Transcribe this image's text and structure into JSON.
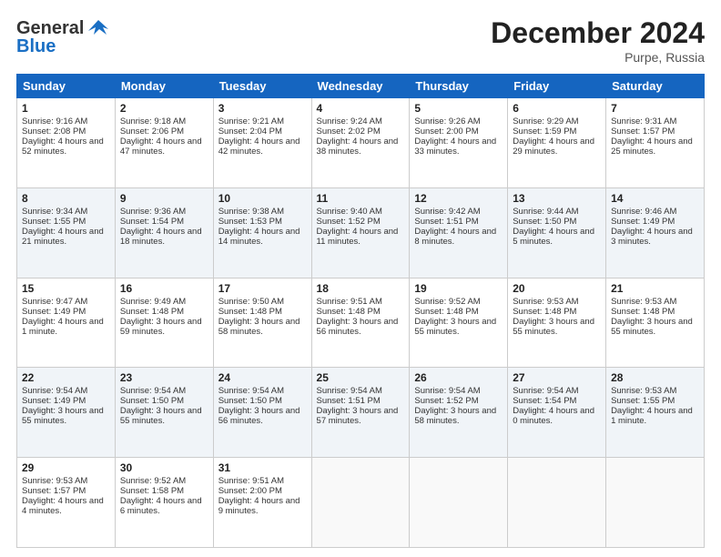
{
  "header": {
    "logo_general": "General",
    "logo_blue": "Blue",
    "month_title": "December 2024",
    "location": "Purpe, Russia"
  },
  "days_of_week": [
    "Sunday",
    "Monday",
    "Tuesday",
    "Wednesday",
    "Thursday",
    "Friday",
    "Saturday"
  ],
  "weeks": [
    [
      {
        "day": "1",
        "sunrise": "Sunrise: 9:16 AM",
        "sunset": "Sunset: 2:08 PM",
        "daylight": "Daylight: 4 hours and 52 minutes."
      },
      {
        "day": "2",
        "sunrise": "Sunrise: 9:18 AM",
        "sunset": "Sunset: 2:06 PM",
        "daylight": "Daylight: 4 hours and 47 minutes."
      },
      {
        "day": "3",
        "sunrise": "Sunrise: 9:21 AM",
        "sunset": "Sunset: 2:04 PM",
        "daylight": "Daylight: 4 hours and 42 minutes."
      },
      {
        "day": "4",
        "sunrise": "Sunrise: 9:24 AM",
        "sunset": "Sunset: 2:02 PM",
        "daylight": "Daylight: 4 hours and 38 minutes."
      },
      {
        "day": "5",
        "sunrise": "Sunrise: 9:26 AM",
        "sunset": "Sunset: 2:00 PM",
        "daylight": "Daylight: 4 hours and 33 minutes."
      },
      {
        "day": "6",
        "sunrise": "Sunrise: 9:29 AM",
        "sunset": "Sunset: 1:59 PM",
        "daylight": "Daylight: 4 hours and 29 minutes."
      },
      {
        "day": "7",
        "sunrise": "Sunrise: 9:31 AM",
        "sunset": "Sunset: 1:57 PM",
        "daylight": "Daylight: 4 hours and 25 minutes."
      }
    ],
    [
      {
        "day": "8",
        "sunrise": "Sunrise: 9:34 AM",
        "sunset": "Sunset: 1:55 PM",
        "daylight": "Daylight: 4 hours and 21 minutes."
      },
      {
        "day": "9",
        "sunrise": "Sunrise: 9:36 AM",
        "sunset": "Sunset: 1:54 PM",
        "daylight": "Daylight: 4 hours and 18 minutes."
      },
      {
        "day": "10",
        "sunrise": "Sunrise: 9:38 AM",
        "sunset": "Sunset: 1:53 PM",
        "daylight": "Daylight: 4 hours and 14 minutes."
      },
      {
        "day": "11",
        "sunrise": "Sunrise: 9:40 AM",
        "sunset": "Sunset: 1:52 PM",
        "daylight": "Daylight: 4 hours and 11 minutes."
      },
      {
        "day": "12",
        "sunrise": "Sunrise: 9:42 AM",
        "sunset": "Sunset: 1:51 PM",
        "daylight": "Daylight: 4 hours and 8 minutes."
      },
      {
        "day": "13",
        "sunrise": "Sunrise: 9:44 AM",
        "sunset": "Sunset: 1:50 PM",
        "daylight": "Daylight: 4 hours and 5 minutes."
      },
      {
        "day": "14",
        "sunrise": "Sunrise: 9:46 AM",
        "sunset": "Sunset: 1:49 PM",
        "daylight": "Daylight: 4 hours and 3 minutes."
      }
    ],
    [
      {
        "day": "15",
        "sunrise": "Sunrise: 9:47 AM",
        "sunset": "Sunset: 1:49 PM",
        "daylight": "Daylight: 4 hours and 1 minute."
      },
      {
        "day": "16",
        "sunrise": "Sunrise: 9:49 AM",
        "sunset": "Sunset: 1:48 PM",
        "daylight": "Daylight: 3 hours and 59 minutes."
      },
      {
        "day": "17",
        "sunrise": "Sunrise: 9:50 AM",
        "sunset": "Sunset: 1:48 PM",
        "daylight": "Daylight: 3 hours and 58 minutes."
      },
      {
        "day": "18",
        "sunrise": "Sunrise: 9:51 AM",
        "sunset": "Sunset: 1:48 PM",
        "daylight": "Daylight: 3 hours and 56 minutes."
      },
      {
        "day": "19",
        "sunrise": "Sunrise: 9:52 AM",
        "sunset": "Sunset: 1:48 PM",
        "daylight": "Daylight: 3 hours and 55 minutes."
      },
      {
        "day": "20",
        "sunrise": "Sunrise: 9:53 AM",
        "sunset": "Sunset: 1:48 PM",
        "daylight": "Daylight: 3 hours and 55 minutes."
      },
      {
        "day": "21",
        "sunrise": "Sunrise: 9:53 AM",
        "sunset": "Sunset: 1:48 PM",
        "daylight": "Daylight: 3 hours and 55 minutes."
      }
    ],
    [
      {
        "day": "22",
        "sunrise": "Sunrise: 9:54 AM",
        "sunset": "Sunset: 1:49 PM",
        "daylight": "Daylight: 3 hours and 55 minutes."
      },
      {
        "day": "23",
        "sunrise": "Sunrise: 9:54 AM",
        "sunset": "Sunset: 1:50 PM",
        "daylight": "Daylight: 3 hours and 55 minutes."
      },
      {
        "day": "24",
        "sunrise": "Sunrise: 9:54 AM",
        "sunset": "Sunset: 1:50 PM",
        "daylight": "Daylight: 3 hours and 56 minutes."
      },
      {
        "day": "25",
        "sunrise": "Sunrise: 9:54 AM",
        "sunset": "Sunset: 1:51 PM",
        "daylight": "Daylight: 3 hours and 57 minutes."
      },
      {
        "day": "26",
        "sunrise": "Sunrise: 9:54 AM",
        "sunset": "Sunset: 1:52 PM",
        "daylight": "Daylight: 3 hours and 58 minutes."
      },
      {
        "day": "27",
        "sunrise": "Sunrise: 9:54 AM",
        "sunset": "Sunset: 1:54 PM",
        "daylight": "Daylight: 4 hours and 0 minutes."
      },
      {
        "day": "28",
        "sunrise": "Sunrise: 9:53 AM",
        "sunset": "Sunset: 1:55 PM",
        "daylight": "Daylight: 4 hours and 1 minute."
      }
    ],
    [
      {
        "day": "29",
        "sunrise": "Sunrise: 9:53 AM",
        "sunset": "Sunset: 1:57 PM",
        "daylight": "Daylight: 4 hours and 4 minutes."
      },
      {
        "day": "30",
        "sunrise": "Sunrise: 9:52 AM",
        "sunset": "Sunset: 1:58 PM",
        "daylight": "Daylight: 4 hours and 6 minutes."
      },
      {
        "day": "31",
        "sunrise": "Sunrise: 9:51 AM",
        "sunset": "Sunset: 2:00 PM",
        "daylight": "Daylight: 4 hours and 9 minutes."
      },
      null,
      null,
      null,
      null
    ]
  ]
}
